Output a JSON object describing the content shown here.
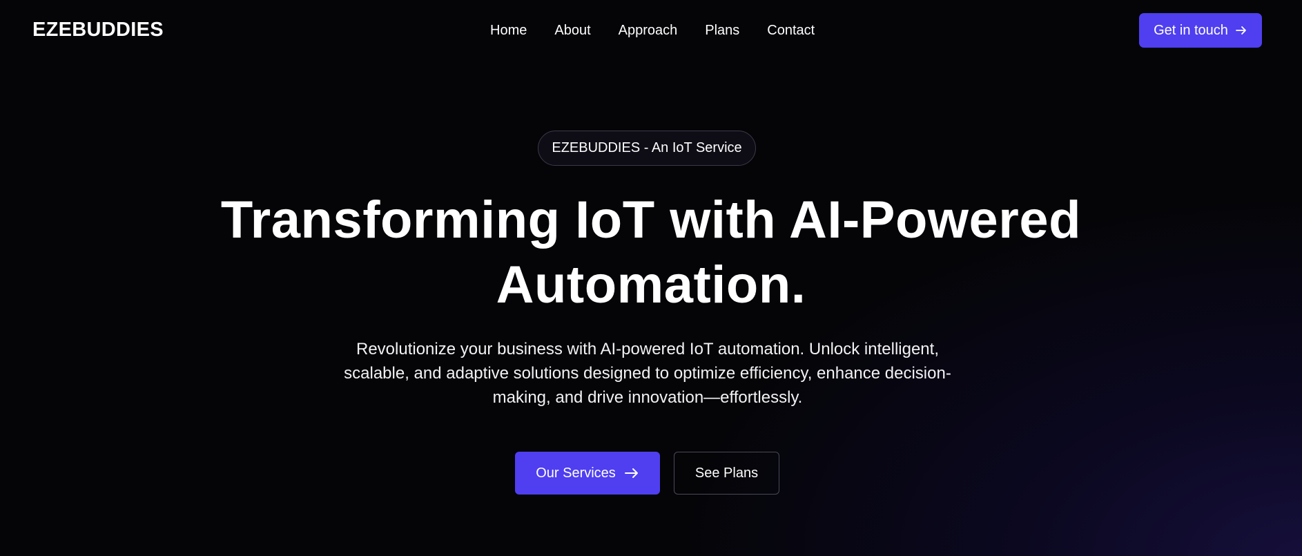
{
  "header": {
    "logo": "EZEBUDDIES",
    "nav": [
      {
        "label": "Home"
      },
      {
        "label": "About"
      },
      {
        "label": "Approach"
      },
      {
        "label": "Plans"
      },
      {
        "label": "Contact"
      }
    ],
    "cta_label": "Get in touch",
    "cta_icon": "arrow-right-icon"
  },
  "hero": {
    "badge": "EZEBUDDIES - An IoT Service",
    "headline_line1": "Transforming IoT with AI-Powered",
    "headline_line2": "Automation.",
    "subtext_line1": "Revolutionize your business with AI-powered IoT automation. Unlock intelligent,",
    "subtext_line2": "scalable, and adaptive solutions designed to optimize efficiency, enhance decision-",
    "subtext_line3": "making, and drive innovation—effortlessly.",
    "primary_button": "Our Services",
    "primary_icon": "arrow-right-icon",
    "secondary_button": "See Plans"
  },
  "colors": {
    "accent": "#4f3ff0",
    "background": "#050508",
    "text": "#ffffff"
  }
}
